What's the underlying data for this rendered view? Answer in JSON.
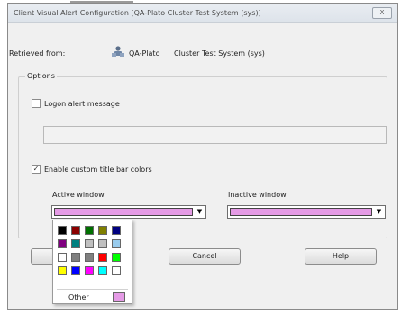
{
  "window": {
    "title": "Client Visual Alert Configuration [QA-Plato     Cluster Test System (sys)]",
    "close_label": "X"
  },
  "retrieved": {
    "label": "Retrieved from:",
    "server": "QA-Plato",
    "system": "Cluster Test System (sys)"
  },
  "options": {
    "legend": "Options",
    "logon_alert_label": "Logon alert message",
    "logon_alert_checked": false,
    "logon_alert_value": "",
    "custom_colors_label": "Enable custom title bar colors",
    "custom_colors_checked": true,
    "active_window_label": "Active window",
    "inactive_window_label": "Inactive window",
    "active_color": "#e59be6",
    "inactive_color": "#e59be6"
  },
  "buttons": {
    "ok": "",
    "cancel": "Cancel",
    "help": "Help"
  },
  "color_popup": {
    "palette": [
      [
        "#000000",
        "#8b0000",
        "#007000",
        "#808000",
        "#000080"
      ],
      [
        "#800080",
        "#008080",
        "#c0c0c0",
        "#c0c0c0",
        "#99ccee"
      ],
      [
        "#ffffff",
        "#808080",
        "#808080",
        "#ff0000",
        "#00ff00"
      ],
      [
        "#ffff00",
        "#0000ff",
        "#ff00ff",
        "#00ffff",
        "#ffffff"
      ]
    ],
    "other_label": "Other",
    "other_color": "#e59be6"
  }
}
